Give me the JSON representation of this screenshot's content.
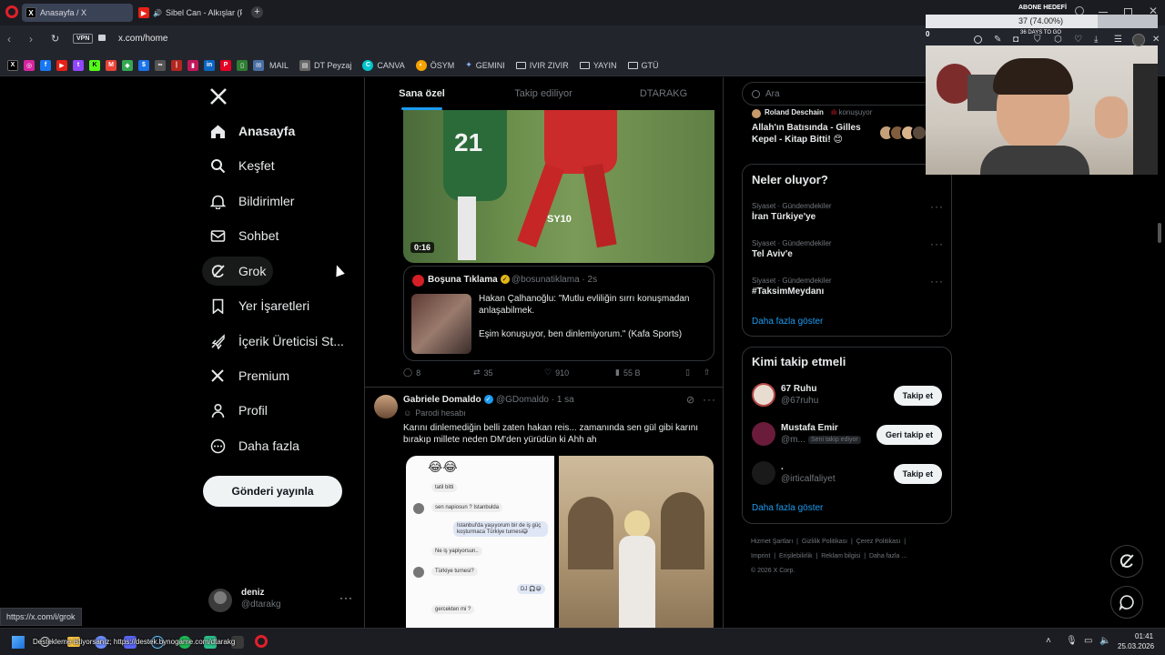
{
  "browser": {
    "tabs": [
      {
        "label": "Anasayfa / X",
        "active": true
      },
      {
        "label": "Sibel Can - Alkışlar (Pr",
        "active": false
      }
    ],
    "vpn_label": "VPN",
    "url": "x.com/home",
    "bookmarks": [
      "MAIL",
      "DT Peyzaj",
      "CANVA",
      "ÖSYM",
      "GEMINI",
      "IVIR ZIVIR",
      "YAYIN",
      "GTÜ"
    ]
  },
  "overlay": {
    "goal_title": "ABONE HEDEFİ",
    "goal_value": "37 (74.00%)",
    "goal_left": "0",
    "days_to_go": "36 DAYS TO GO"
  },
  "sidebar": {
    "items": [
      {
        "label": "Anasayfa",
        "icon": "home-icon"
      },
      {
        "label": "Keşfet",
        "icon": "search-icon"
      },
      {
        "label": "Bildirimler",
        "icon": "bell-icon"
      },
      {
        "label": "Sohbet",
        "icon": "mail-icon"
      },
      {
        "label": "Grok",
        "icon": "grok-icon"
      },
      {
        "label": "Yer İşaretleri",
        "icon": "bookmark-icon"
      },
      {
        "label": "İçerik Üreticisi St...",
        "icon": "rocket-icon"
      },
      {
        "label": "Premium",
        "icon": "x-icon"
      },
      {
        "label": "Profil",
        "icon": "person-icon"
      },
      {
        "label": "Daha fazla",
        "icon": "more-circle-icon"
      }
    ],
    "post_button": "Gönderi yayınla",
    "account_name": "deniz",
    "account_handle": "@dtarakg"
  },
  "feed": {
    "tabs": [
      "Sana özel",
      "Takip ediliyor",
      "DTARAKG"
    ],
    "video_duration": "0:16",
    "video_overlay": "SY10",
    "quote": {
      "name": "Boşuna Tıklama",
      "handle": "@bosunatiklama",
      "time": "2s",
      "text1": "Hakan Çalhanoğlu: \"Mutlu evliliğin sırrı konuşmadan anlaşabilmek.",
      "text2": "Eşim konuşuyor, ben dinlemiyorum.\" (Kafa Sports)"
    },
    "actions": {
      "replies": "8",
      "reposts": "35",
      "likes": "910",
      "views": "55 B"
    },
    "post2": {
      "name": "Gabriele Domaldo",
      "handle": "@GDomaldo",
      "time": "1 sa",
      "parody": "Parodi hesabı",
      "text": "Karını dinlemediğin belli zaten hakan reis... zamanında sen gül gibi karını bırakıp millete neden DM'den yürüdün ki Ahh ah"
    },
    "chat": {
      "emoji": "😂😂",
      "m1": "tatil bitti",
      "m2": "sen napiosun ? Istanbulda",
      "m3": "Istanbul'da yaşıyorum bir de iş güç koşturmaca Türkiye turnesi😅",
      "m4": "Ne iş yapiyorsun..",
      "m5": "Türkiye turnesi?",
      "m6": "DJ 🎧😅",
      "m7": "gercekten mi ?"
    }
  },
  "right": {
    "search_placeholder": "Ara",
    "space": {
      "host": "Roland Deschain",
      "status": "konuşuyor",
      "title": "Allah'ın Batısında - Gilles Kepel - Kitap Bitti! 😊"
    },
    "trends_title": "Neler oluyor?",
    "trends": [
      {
        "category": "Siyaset · Gündemdekiler",
        "title": "İran Türkiye'ye"
      },
      {
        "category": "Siyaset · Gündemdekiler",
        "title": "Tel Aviv'e"
      },
      {
        "category": "Siyaset · Gündemdekiler",
        "title": "#TaksimMeydanı"
      }
    ],
    "trends_more": "Daha fazla göster",
    "who_title": "Kimi takip etmeli",
    "who": [
      {
        "name": "67 Ruhu",
        "handle": "@67ruhu",
        "button": "Takip et",
        "badge": ""
      },
      {
        "name": "Mustafa Emir",
        "handle": "@m...",
        "button": "Geri takip et",
        "badge": "Seni takip ediyor"
      },
      {
        "name": ".",
        "handle": "@irticalfaliyet",
        "button": "Takip et",
        "badge": ""
      }
    ],
    "who_more": "Daha fazla göster",
    "footer": [
      "Hizmet Şartları",
      "Gizlilik Politikası",
      "Çerez Politikası",
      "Imprint",
      "Erişilebilirlik",
      "Reklam bilgisi",
      "Daha fazla ...",
      "© 2026 X Corp."
    ]
  },
  "status_url": "https://x.com/i/grok",
  "taskbar": {
    "ticker": "Destekleme istiyorsanız; https://destek.bynogame.com/dtarakg",
    "time": "01:41",
    "date": "25.03.2026"
  },
  "colors": {
    "accent": "#1d9bf0",
    "background": "#000000",
    "border": "#2f3336",
    "muted": "#71767b"
  }
}
